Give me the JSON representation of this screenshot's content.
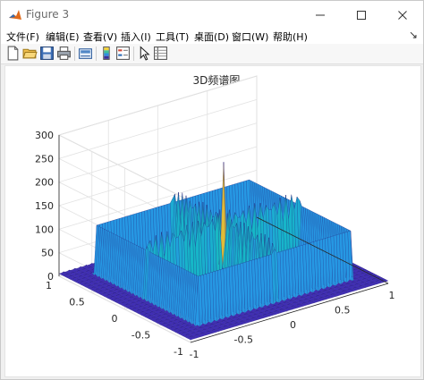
{
  "window": {
    "title": "Figure 3"
  },
  "menu": {
    "items": [
      "文件(F)",
      "编辑(E)",
      "查看(V)",
      "插入(I)",
      "工具(T)",
      "桌面(D)",
      "窗口(W)",
      "帮助(H)"
    ],
    "dock_label": "↘"
  },
  "toolbar": {
    "buttons": [
      "new-figure",
      "open-file",
      "save-figure",
      "print-figure",
      "link-plot",
      "colorbar",
      "legend",
      "edit-plot",
      "property-inspector"
    ]
  },
  "chart_data": {
    "type": "surface",
    "title": "3D频谱图",
    "xlabel": "",
    "ylabel": "",
    "zlabel": "",
    "x_range": [
      -1,
      1
    ],
    "y_range": [
      -1,
      1
    ],
    "z_range": [
      0,
      300
    ],
    "x_ticks": [
      "-1",
      "-0.5",
      "0",
      "0.5",
      "1"
    ],
    "y_ticks": [
      "-1",
      "-0.5",
      "0",
      "0.5",
      "1"
    ],
    "z_ticks": [
      "0",
      "50",
      "100",
      "150",
      "200",
      "250",
      "300"
    ],
    "peak": {
      "x": 0,
      "y": 0,
      "z": 250
    },
    "ridge_cross_height": 150,
    "ridge_edge_height": 140,
    "background_level": 10,
    "colormap": "parula",
    "grid": true
  }
}
